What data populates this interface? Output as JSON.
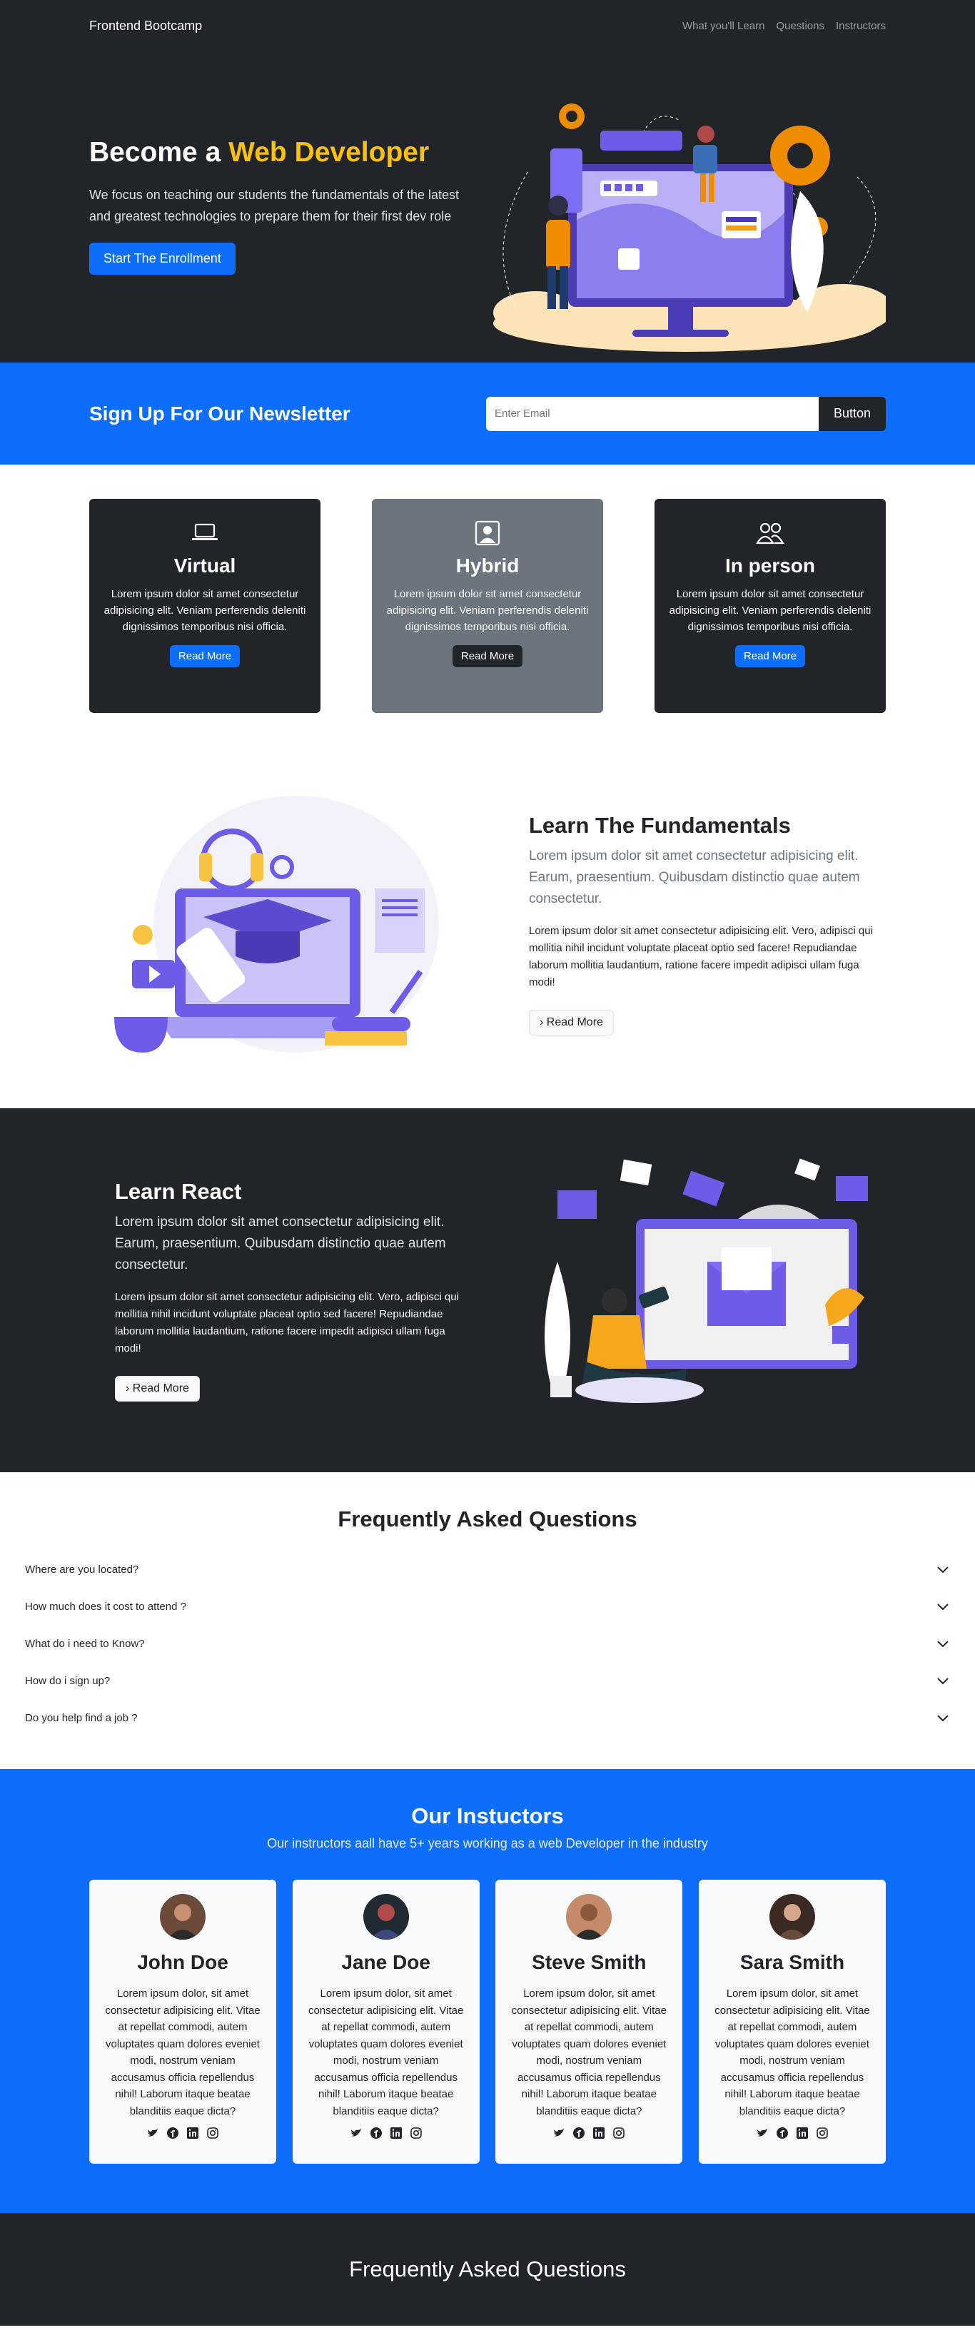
{
  "nav": {
    "brand": "Frontend Bootcamp",
    "links": [
      "What you'll Learn",
      "Questions",
      "Instructors"
    ]
  },
  "hero": {
    "title_prefix": "Become a ",
    "title_accent": "Web Developer",
    "lead": "We focus on teaching our students the fundamentals of the latest and greatest technologies to prepare them for their first dev role",
    "cta": "Start The Enrollment"
  },
  "newsletter": {
    "title": "Sign Up For Our Newsletter",
    "placeholder": "Enter Email",
    "button": "Button"
  },
  "boxes": [
    {
      "title": "Virtual",
      "text": "Lorem ipsum dolor sit amet consectetur adipisicing elit. Veniam perferendis deleniti dignissimos temporibus nisi officia.",
      "button": "Read More",
      "icon": "laptop-icon"
    },
    {
      "title": "Hybrid",
      "text": "Lorem ipsum dolor sit amet consectetur adipisicing elit. Veniam perferendis deleniti dignissimos temporibus nisi officia.",
      "button": "Read More",
      "icon": "person-badge-icon"
    },
    {
      "title": "In person",
      "text": "Lorem ipsum dolor sit amet consectetur adipisicing elit. Veniam perferendis deleniti dignissimos temporibus nisi officia.",
      "button": "Read More",
      "icon": "people-icon"
    }
  ],
  "fundamentals": {
    "title": "Learn The Fundamentals",
    "lead": "Lorem ipsum dolor sit amet consectetur adipisicing elit. Earum, praesentium. Quibusdam distinctio quae autem consectetur.",
    "body": "Lorem ipsum dolor sit amet consectetur adipisicing elit. Vero, adipisci qui mollitia nihil incidunt voluptate placeat optio sed facere! Repudiandae laborum mollitia laudantium, ratione facere impedit adipisci ullam fuga modi!",
    "button": "Read More"
  },
  "react": {
    "title": "Learn React",
    "lead": "Lorem ipsum dolor sit amet consectetur adipisicing elit. Earum, praesentium. Quibusdam distinctio quae autem consectetur.",
    "body": "Lorem ipsum dolor sit amet consectetur adipisicing elit. Vero, adipisci qui mollitia nihil incidunt voluptate placeat optio sed facere! Repudiandae laborum mollitia laudantium, ratione facere impedit adipisci ullam fuga modi!",
    "button": "Read More"
  },
  "faq": {
    "title": "Frequently Asked Questions",
    "items": [
      "Where are you located?",
      "How much does it cost to attend ?",
      "What do i need to Know?",
      "How do i sign up?",
      "Do you help find a job ?"
    ]
  },
  "instructors": {
    "title": "Our Instuctors",
    "lead": "Our instructors aall have 5+ years working as a web Developer in the industry",
    "cards": [
      {
        "name": "John Doe",
        "text": "Lorem ipsum dolor, sit amet consectetur adipisicing elit. Vitae at repellat commodi, autem voluptates quam dolores eveniet modi, nostrum veniam accusamus officia repellendus nihil! Laborum itaque beatae blanditiis eaque dicta?",
        "avatar_color": "#6b4a3a"
      },
      {
        "name": "Jane Doe",
        "text": "Lorem ipsum dolor, sit amet consectetur adipisicing elit. Vitae at repellat commodi, autem voluptates quam dolores eveniet modi, nostrum veniam accusamus officia repellendus nihil! Laborum itaque beatae blanditiis eaque dicta?",
        "avatar_color": "#1f2a33"
      },
      {
        "name": "Steve Smith",
        "text": "Lorem ipsum dolor, sit amet consectetur adipisicing elit. Vitae at repellat commodi, autem voluptates quam dolores eveniet modi, nostrum veniam accusamus officia repellendus nihil! Laborum itaque beatae blanditiis eaque dicta?",
        "avatar_color": "#c48a6a"
      },
      {
        "name": "Sara Smith",
        "text": "Lorem ipsum dolor, sit amet consectetur adipisicing elit. Vitae at repellat commodi, autem voluptates quam dolores eveniet modi, nostrum veniam accusamus officia repellendus nihil! Laborum itaque beatae blanditiis eaque dicta?",
        "avatar_color": "#3a2a22"
      }
    ]
  },
  "footer": {
    "title": "Frequently Asked Questions"
  },
  "colors": {
    "dark": "#212529",
    "primary": "#0d6efd",
    "warning": "#ffc107",
    "secondary": "#6c757d",
    "illustration_purple": "#6c5ce7"
  }
}
